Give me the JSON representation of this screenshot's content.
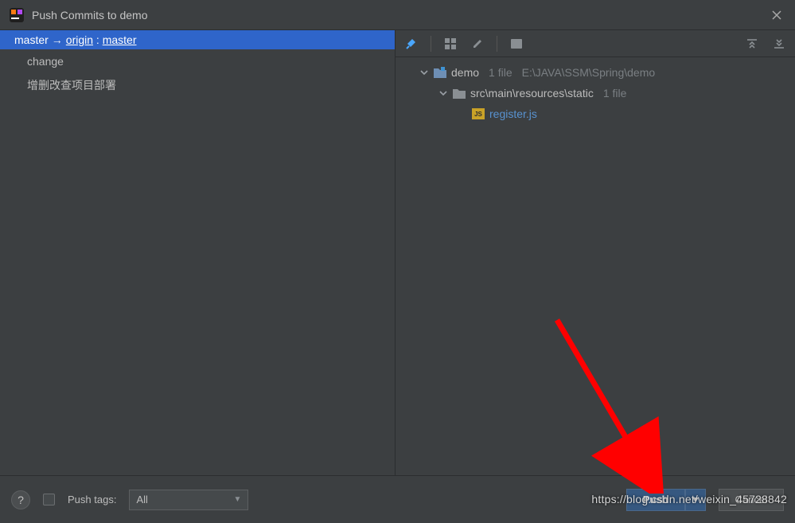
{
  "window": {
    "title": "Push Commits to demo"
  },
  "left": {
    "branch_local": "master",
    "branch_remote": "origin",
    "branch_remote_ref": "master",
    "commits": [
      {
        "label": "change"
      },
      {
        "label": "增删改查项目部署"
      }
    ]
  },
  "right": {
    "tree": {
      "project": {
        "name": "demo",
        "file_count_label": "1 file",
        "path": "E:\\JAVA\\SSM\\Spring\\demo"
      },
      "folder": {
        "name": "src\\main\\resources\\static",
        "file_count_label": "1 file"
      },
      "file": {
        "name": "register.js",
        "icon_text": "JS"
      }
    }
  },
  "footer": {
    "push_tags_label": "Push tags:",
    "push_tags_value": "All",
    "push_button": "Push",
    "cancel_button": "Cancel"
  },
  "watermark": "https://blog.csdn.net/weixin_45728842"
}
